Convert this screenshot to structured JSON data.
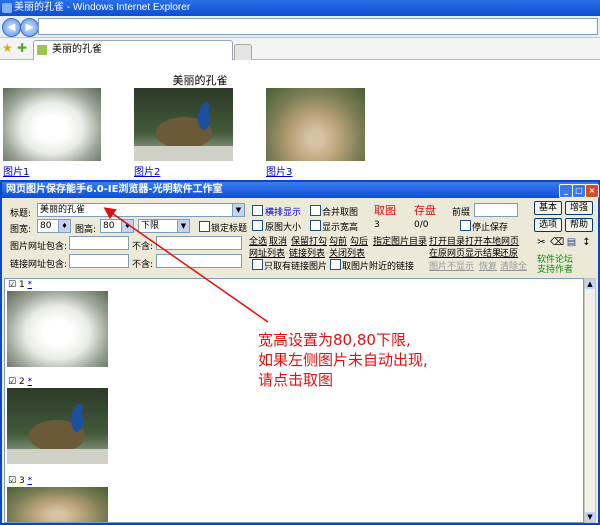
{
  "browser": {
    "window_title": "美丽的孔雀 - Windows Internet Explorer",
    "address_value": "",
    "tab_label": "美丽的孔雀"
  },
  "page": {
    "heading": "美丽的孔雀",
    "images": [
      {
        "label": "图片1"
      },
      {
        "label": "图片2"
      },
      {
        "label": "图片3"
      }
    ]
  },
  "app": {
    "title": "网页图片保存能手6.0-IE浏览器-光明软件工作室",
    "title_label": "标题:",
    "title_value": "美丽的孔雀",
    "width_label": "图宽:",
    "width_value": "80",
    "height_label": "图高:",
    "height_value": "80",
    "limit_value": "下限",
    "lock_title": "锁定标题",
    "url_include_label": "图片网址包含:",
    "exclude_label": "不含:",
    "link_include_label": "链接网址包含:",
    "exclude_label2": "不含:",
    "opt_horizontal": "横排显示",
    "opt_merge": "合并取图",
    "opt_original": "原图大小",
    "opt_show_wh": "显示宽高",
    "grab": "取图",
    "save": "存盘",
    "prefix_label": "前缀",
    "stop_save": "停止保存",
    "count_value": "3",
    "ratio_value": "0/0",
    "links_row1": [
      "全选",
      "取消",
      "保留打勾",
      "勾前",
      "勾后",
      "指定图片目录",
      "打开目录",
      "打开本地网页"
    ],
    "links_row2": [
      "网址列表",
      "链接列表",
      "关闭列表",
      "在原网页显示结果",
      "还原"
    ],
    "only_linked": "只取有链接图片",
    "near_link": "取图片附近的链接",
    "gray_links": [
      "图片不显示",
      "恢复",
      "清除全"
    ],
    "btn_basic": "基本",
    "btn_enhance": "增强",
    "btn_options": "选项",
    "btn_help": "帮助",
    "forum": "软件论坛",
    "support": "支持作者",
    "list_items": [
      {
        "index": "1",
        "mark": "*"
      },
      {
        "index": "2",
        "mark": "*"
      },
      {
        "index": "3",
        "mark": "*"
      }
    ],
    "annotation": [
      "宽高设置为80,80下限,",
      "如果左侧图片未自动出现,",
      "请点击取图"
    ]
  },
  "colors": {
    "accent": "#0a47c7",
    "annotation": "#e01010",
    "grab": "#e01010",
    "forum": "#118811"
  }
}
